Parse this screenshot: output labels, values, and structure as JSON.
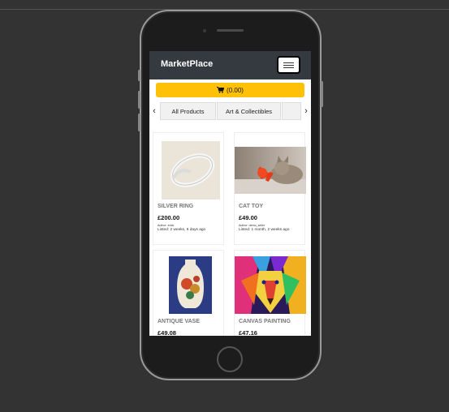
{
  "app": {
    "brand": "MarketPlace"
  },
  "cart": {
    "label": "(0.00)"
  },
  "tabs": {
    "prev": "‹",
    "next": "›",
    "items": [
      {
        "label": "All Products"
      },
      {
        "label": "Art & Collectibles"
      }
    ]
  },
  "products": [
    {
      "title": "SILVER RING",
      "price": "£200.00",
      "author": "Author: erick",
      "listed": "Listed: 2 weeks, 6 days ago"
    },
    {
      "title": "CAT TOY",
      "price": "£49.00",
      "author": "Author: demo_seller",
      "listed": "Listed: 1 month, 2 weeks ago"
    },
    {
      "title": "ANTIQUE VASE",
      "price": "£49.08"
    },
    {
      "title": "CANVAS PAINTING",
      "price": "£47.16"
    }
  ],
  "colors": {
    "navbar": "#343a40",
    "cart_button": "#ffc107",
    "page_bg": "#333333"
  }
}
